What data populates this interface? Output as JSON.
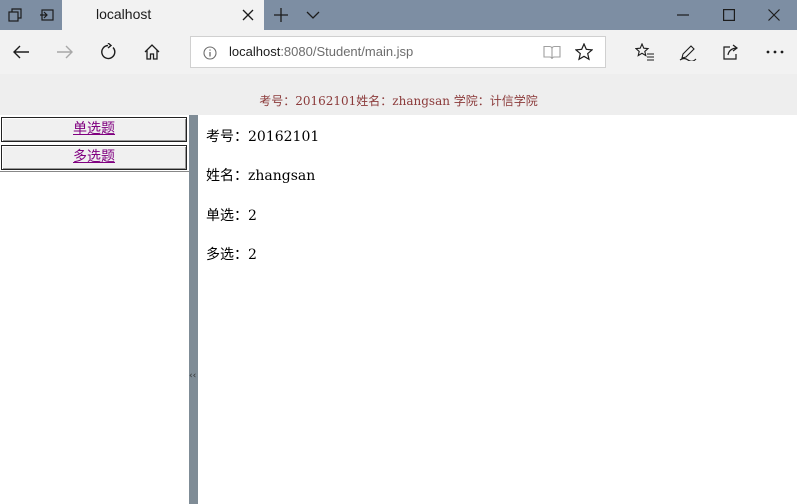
{
  "browser": {
    "tab_title": "localhost",
    "url_host": "localhost",
    "url_rest": ":8080/Student/main.jsp"
  },
  "header": {
    "info_line": "考号：20162101姓名：zhangsan 学院：计信学院"
  },
  "sidebar": {
    "items": [
      {
        "label": "单选题"
      },
      {
        "label": "多选题"
      }
    ]
  },
  "main": {
    "rows": [
      {
        "label": "考号：",
        "value": "20162101"
      },
      {
        "label": "姓名：",
        "value": "zhangsan"
      },
      {
        "label": "单选：",
        "value": "2"
      },
      {
        "label": "多选：",
        "value": "2"
      }
    ]
  },
  "icons": [
    "tab-actions-icon",
    "set-aside-tabs-icon",
    "close-icon",
    "new-tab-icon",
    "chevron-down-icon",
    "minimize-icon",
    "maximize-icon",
    "back-icon",
    "forward-icon",
    "refresh-icon",
    "home-icon",
    "info-icon",
    "reading-view-icon",
    "favorite-star-icon",
    "favorites-hub-icon",
    "pen-icon",
    "share-icon",
    "more-icon"
  ],
  "colors": {
    "titlebar": "#7d8ea3",
    "info_text": "#8b3a3a",
    "visited_link": "#800080",
    "splitter": "#7f8c96"
  }
}
